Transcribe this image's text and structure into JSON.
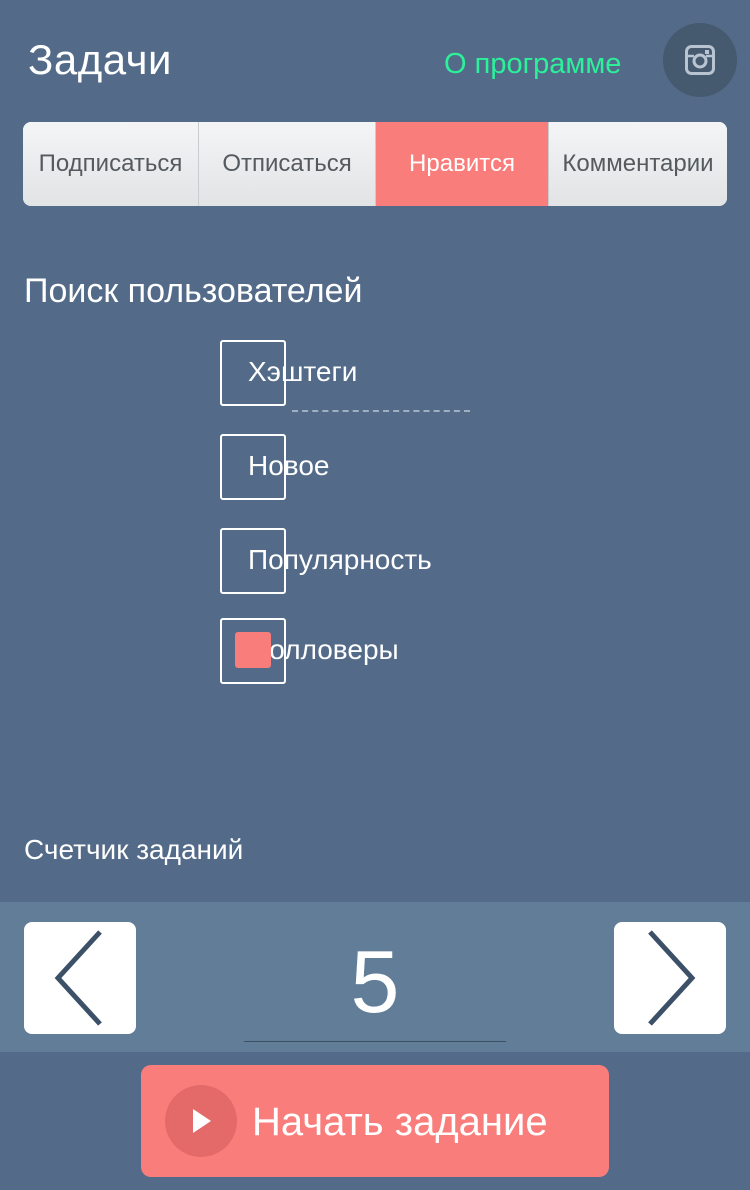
{
  "header": {
    "title": "Задачи",
    "about_link": "О программе",
    "instagram_icon": "instagram-icon"
  },
  "tabs": [
    {
      "label": "Подписаться",
      "active": false
    },
    {
      "label": "Отписаться",
      "active": false
    },
    {
      "label": "Нравится",
      "active": true
    },
    {
      "label": "Комментарии",
      "active": false
    }
  ],
  "search": {
    "title": "Поиск пользователей",
    "options": [
      {
        "label": "Хэштеги",
        "checked": false
      },
      {
        "label": "Новое",
        "checked": false
      },
      {
        "label": "Популярность",
        "checked": false
      },
      {
        "label": "Фолловеры",
        "checked": true
      }
    ]
  },
  "counter": {
    "label": "Счетчик заданий",
    "value": "5",
    "decrement_icon": "chevron-left-icon",
    "increment_icon": "chevron-right-icon"
  },
  "start_button": {
    "label": "Начать задание",
    "icon": "play-icon"
  },
  "colors": {
    "background": "#536b89",
    "accent": "#f97d7b",
    "link": "#2cf09a",
    "counter_bar": "#627d98"
  }
}
